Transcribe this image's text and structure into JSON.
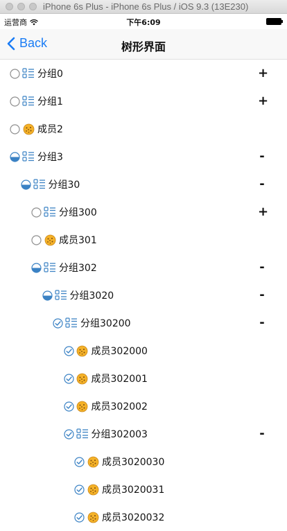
{
  "window": {
    "title": "iPhone 6s Plus - iPhone 6s Plus / iOS 9.3 (13E230)"
  },
  "status_bar": {
    "carrier": "运营商",
    "time": "下午6:09"
  },
  "nav": {
    "back_label": "Back",
    "title": "树形界面"
  },
  "colors": {
    "accent": "#1a7cf5",
    "check_blue": "#3b82c4",
    "avatar": "#f5b228"
  },
  "tree": [
    {
      "label": "分组0",
      "kind": "group",
      "state": "none",
      "level": 0,
      "toggle": "+"
    },
    {
      "label": "分组1",
      "kind": "group",
      "state": "none",
      "level": 0,
      "toggle": "+"
    },
    {
      "label": "成员2",
      "kind": "member",
      "state": "none",
      "level": 0,
      "toggle": ""
    },
    {
      "label": "分组3",
      "kind": "group",
      "state": "partial",
      "level": 0,
      "toggle": "-"
    },
    {
      "label": "分组30",
      "kind": "group",
      "state": "partial",
      "level": 1,
      "toggle": "-"
    },
    {
      "label": "分组300",
      "kind": "group",
      "state": "none",
      "level": 2,
      "toggle": "+"
    },
    {
      "label": "成员301",
      "kind": "member",
      "state": "none",
      "level": 2,
      "toggle": ""
    },
    {
      "label": "分组302",
      "kind": "group",
      "state": "partial",
      "level": 2,
      "toggle": "-"
    },
    {
      "label": "分组3020",
      "kind": "group",
      "state": "partial",
      "level": 3,
      "toggle": "-"
    },
    {
      "label": "分组30200",
      "kind": "group",
      "state": "checked",
      "level": 4,
      "toggle": "-"
    },
    {
      "label": "成员302000",
      "kind": "member",
      "state": "checked",
      "level": 5,
      "toggle": ""
    },
    {
      "label": "成员302001",
      "kind": "member",
      "state": "checked",
      "level": 5,
      "toggle": ""
    },
    {
      "label": "成员302002",
      "kind": "member",
      "state": "checked",
      "level": 5,
      "toggle": ""
    },
    {
      "label": "分组302003",
      "kind": "group",
      "state": "checked",
      "level": 5,
      "toggle": "-"
    },
    {
      "label": "成员3020030",
      "kind": "member",
      "state": "checked",
      "level": 6,
      "toggle": ""
    },
    {
      "label": "成员3020031",
      "kind": "member",
      "state": "checked",
      "level": 6,
      "toggle": ""
    },
    {
      "label": "成员3020032",
      "kind": "member",
      "state": "checked",
      "level": 6,
      "toggle": ""
    }
  ]
}
